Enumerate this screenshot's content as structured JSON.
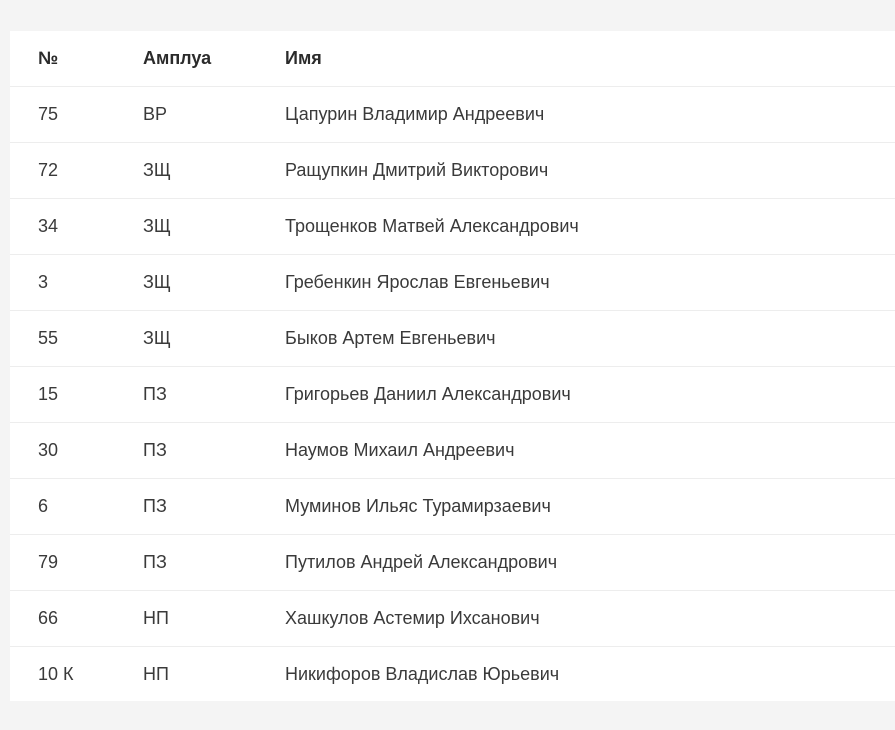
{
  "table": {
    "headers": {
      "number": "№",
      "role": "Амплуа",
      "name": "Имя"
    },
    "rows": [
      {
        "number": "75",
        "role": "ВР",
        "name": "Цапурин Владимир Андреевич"
      },
      {
        "number": "72",
        "role": "ЗЩ",
        "name": "Ращупкин Дмитрий Викторович"
      },
      {
        "number": "34",
        "role": "ЗЩ",
        "name": "Трощенков Матвей Александрович"
      },
      {
        "number": "3",
        "role": "ЗЩ",
        "name": "Гребенкин Ярослав Евгеньевич"
      },
      {
        "number": "55",
        "role": "ЗЩ",
        "name": "Быков Артем Евгеньевич"
      },
      {
        "number": "15",
        "role": "ПЗ",
        "name": "Григорьев Даниил Александрович"
      },
      {
        "number": "30",
        "role": "ПЗ",
        "name": "Наумов Михаил Андреевич"
      },
      {
        "number": "6",
        "role": "ПЗ",
        "name": "Муминов Ильяс Турамирзаевич"
      },
      {
        "number": "79",
        "role": "ПЗ",
        "name": "Путилов Андрей Александрович"
      },
      {
        "number": "66",
        "role": "НП",
        "name": "Хашкулов Астемир Ихсанович"
      },
      {
        "number": "10 К",
        "role": "НП",
        "name": "Никифоров Владислав Юрьевич"
      }
    ]
  }
}
